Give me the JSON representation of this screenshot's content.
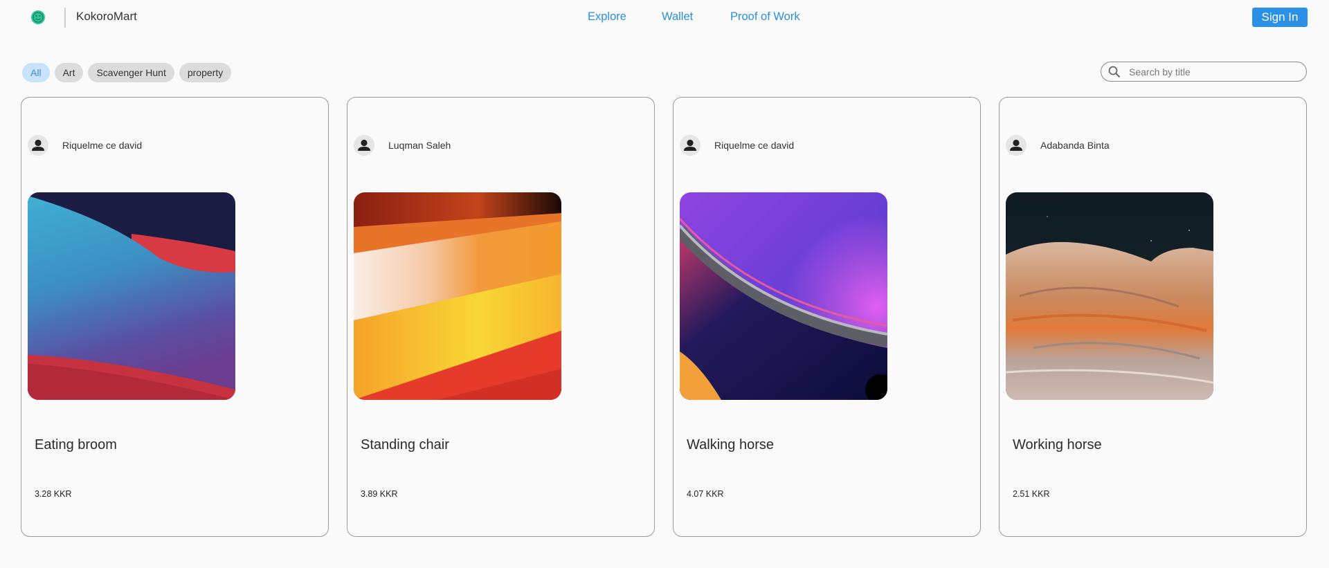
{
  "header": {
    "brand": "KokoroMart",
    "nav": [
      "Explore",
      "Wallet",
      "Proof of Work"
    ],
    "sign_in": "Sign In"
  },
  "filters": {
    "chips": [
      "All",
      "Art",
      "Scavenger Hunt",
      "property"
    ],
    "selected": "All"
  },
  "search": {
    "placeholder": "Search by title",
    "value": ""
  },
  "cards": [
    {
      "owner": "Riquelme ce david",
      "title": "Eating broom",
      "price": "3.28 KKR"
    },
    {
      "owner": "Luqman Saleh",
      "title": "Standing chair",
      "price": "3.89 KKR"
    },
    {
      "owner": "Riquelme ce david",
      "title": "Walking horse",
      "price": "4.07 KKR"
    },
    {
      "owner": "Adabanda Binta",
      "title": "Working horse",
      "price": "2.51 KKR"
    }
  ],
  "colors": {
    "accent": "#2b90e6",
    "chip_active_bg": "#c8e3fb",
    "chip_bg": "#dcdcdc"
  }
}
